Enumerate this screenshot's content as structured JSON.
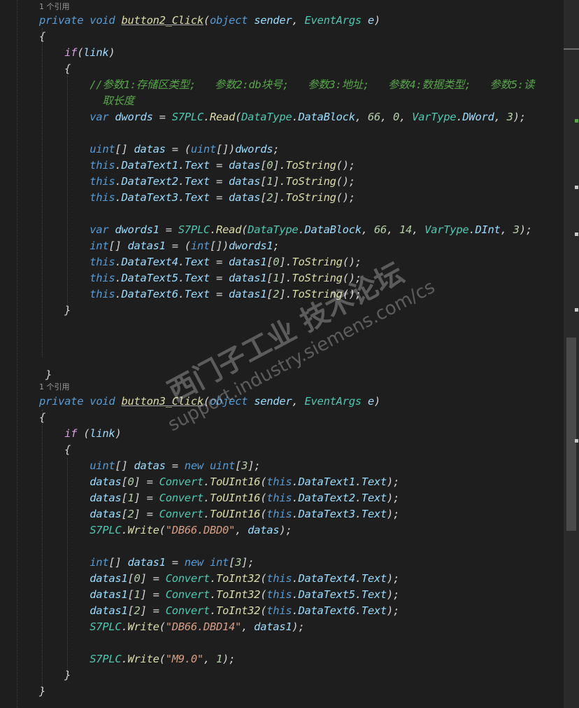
{
  "references": [
    "1 个引用",
    "1 个引用"
  ],
  "code_lines": [
    [
      [
        "kw",
        "private"
      ],
      [
        "pl",
        " "
      ],
      [
        "kw",
        "void"
      ],
      [
        "pl",
        " "
      ],
      [
        "mth",
        "button2_Click"
      ],
      [
        "pl",
        "("
      ],
      [
        "kw",
        "object"
      ],
      [
        "pl",
        " "
      ],
      [
        "id",
        "sender"
      ],
      [
        "pl",
        ", "
      ],
      [
        "typ",
        "EventArgs"
      ],
      [
        "pl",
        " "
      ],
      [
        "id",
        "e"
      ],
      [
        "pl",
        ")"
      ]
    ],
    [
      [
        "pl",
        "{"
      ]
    ],
    [
      [
        "pl",
        "    "
      ],
      [
        "ctl",
        "if"
      ],
      [
        "pl",
        "("
      ],
      [
        "id",
        "link"
      ],
      [
        "pl",
        ")"
      ]
    ],
    [
      [
        "pl",
        "    {"
      ]
    ],
    [
      [
        "pl",
        "        "
      ],
      [
        "com",
        "//参数1:存储区类型;   参数2:db块号;   参数3:地址;   参数4:数据类型;   参数5:读"
      ]
    ],
    [
      [
        "pl",
        "          "
      ],
      [
        "com",
        "取长度"
      ]
    ],
    [
      [
        "pl",
        "        "
      ],
      [
        "kw",
        "var"
      ],
      [
        "pl",
        " "
      ],
      [
        "id",
        "dwords"
      ],
      [
        "pl",
        " = "
      ],
      [
        "typ",
        "S7PLC"
      ],
      [
        "pl",
        "."
      ],
      [
        "mth",
        "Read"
      ],
      [
        "pl",
        "("
      ],
      [
        "typ",
        "DataType"
      ],
      [
        "pl",
        "."
      ],
      [
        "id",
        "DataBlock"
      ],
      [
        "pl",
        ", "
      ],
      [
        "num",
        "66"
      ],
      [
        "pl",
        ", "
      ],
      [
        "num",
        "0"
      ],
      [
        "pl",
        ", "
      ],
      [
        "typ",
        "VarType"
      ],
      [
        "pl",
        "."
      ],
      [
        "id",
        "DWord"
      ],
      [
        "pl",
        ", "
      ],
      [
        "num",
        "3"
      ],
      [
        "pl",
        ");"
      ]
    ],
    [
      [
        "pl",
        ""
      ]
    ],
    [
      [
        "pl",
        "        "
      ],
      [
        "kw",
        "uint"
      ],
      [
        "pl",
        "[] "
      ],
      [
        "id",
        "datas"
      ],
      [
        "pl",
        " = ("
      ],
      [
        "kw",
        "uint"
      ],
      [
        "pl",
        "[])"
      ],
      [
        "id",
        "dwords"
      ],
      [
        "pl",
        ";"
      ]
    ],
    [
      [
        "pl",
        "        "
      ],
      [
        "thisk",
        "this"
      ],
      [
        "pl",
        "."
      ],
      [
        "id",
        "DataText1"
      ],
      [
        "pl",
        "."
      ],
      [
        "id",
        "Text"
      ],
      [
        "pl",
        " = "
      ],
      [
        "id",
        "datas"
      ],
      [
        "pl",
        "["
      ],
      [
        "num",
        "0"
      ],
      [
        "pl",
        "]."
      ],
      [
        "mth",
        "ToString"
      ],
      [
        "pl",
        "();"
      ]
    ],
    [
      [
        "pl",
        "        "
      ],
      [
        "thisk",
        "this"
      ],
      [
        "pl",
        "."
      ],
      [
        "id",
        "DataText2"
      ],
      [
        "pl",
        "."
      ],
      [
        "id",
        "Text"
      ],
      [
        "pl",
        " = "
      ],
      [
        "id",
        "datas"
      ],
      [
        "pl",
        "["
      ],
      [
        "num",
        "1"
      ],
      [
        "pl",
        "]."
      ],
      [
        "mth",
        "ToString"
      ],
      [
        "pl",
        "();"
      ]
    ],
    [
      [
        "pl",
        "        "
      ],
      [
        "thisk",
        "this"
      ],
      [
        "pl",
        "."
      ],
      [
        "id",
        "DataText3"
      ],
      [
        "pl",
        "."
      ],
      [
        "id",
        "Text"
      ],
      [
        "pl",
        " = "
      ],
      [
        "id",
        "datas"
      ],
      [
        "pl",
        "["
      ],
      [
        "num",
        "2"
      ],
      [
        "pl",
        "]."
      ],
      [
        "mth",
        "ToString"
      ],
      [
        "pl",
        "();"
      ]
    ],
    [
      [
        "pl",
        ""
      ]
    ],
    [
      [
        "pl",
        "        "
      ],
      [
        "kw",
        "var"
      ],
      [
        "pl",
        " "
      ],
      [
        "id",
        "dwords1"
      ],
      [
        "pl",
        " = "
      ],
      [
        "typ",
        "S7PLC"
      ],
      [
        "pl",
        "."
      ],
      [
        "mth",
        "Read"
      ],
      [
        "pl",
        "("
      ],
      [
        "typ",
        "DataType"
      ],
      [
        "pl",
        "."
      ],
      [
        "id",
        "DataBlock"
      ],
      [
        "pl",
        ", "
      ],
      [
        "num",
        "66"
      ],
      [
        "pl",
        ", "
      ],
      [
        "num",
        "14"
      ],
      [
        "pl",
        ", "
      ],
      [
        "typ",
        "VarType"
      ],
      [
        "pl",
        "."
      ],
      [
        "id",
        "DInt"
      ],
      [
        "pl",
        ", "
      ],
      [
        "num",
        "3"
      ],
      [
        "pl",
        ");"
      ]
    ],
    [
      [
        "pl",
        "        "
      ],
      [
        "kw",
        "int"
      ],
      [
        "pl",
        "[] "
      ],
      [
        "id",
        "datas1"
      ],
      [
        "pl",
        " = ("
      ],
      [
        "kw",
        "int"
      ],
      [
        "pl",
        "[])"
      ],
      [
        "id",
        "dwords1"
      ],
      [
        "pl",
        ";"
      ]
    ],
    [
      [
        "pl",
        "        "
      ],
      [
        "thisk",
        "this"
      ],
      [
        "pl",
        "."
      ],
      [
        "id",
        "DataText4"
      ],
      [
        "pl",
        "."
      ],
      [
        "id",
        "Text"
      ],
      [
        "pl",
        " = "
      ],
      [
        "id",
        "datas1"
      ],
      [
        "pl",
        "["
      ],
      [
        "num",
        "0"
      ],
      [
        "pl",
        "]."
      ],
      [
        "mth",
        "ToString"
      ],
      [
        "pl",
        "();"
      ]
    ],
    [
      [
        "pl",
        "        "
      ],
      [
        "thisk",
        "this"
      ],
      [
        "pl",
        "."
      ],
      [
        "id",
        "DataText5"
      ],
      [
        "pl",
        "."
      ],
      [
        "id",
        "Text"
      ],
      [
        "pl",
        " = "
      ],
      [
        "id",
        "datas1"
      ],
      [
        "pl",
        "["
      ],
      [
        "num",
        "1"
      ],
      [
        "pl",
        "]."
      ],
      [
        "mth",
        "ToString"
      ],
      [
        "pl",
        "();"
      ]
    ],
    [
      [
        "pl",
        "        "
      ],
      [
        "thisk",
        "this"
      ],
      [
        "pl",
        "."
      ],
      [
        "id",
        "DataText6"
      ],
      [
        "pl",
        "."
      ],
      [
        "id",
        "Text"
      ],
      [
        "pl",
        " = "
      ],
      [
        "id",
        "datas1"
      ],
      [
        "pl",
        "["
      ],
      [
        "num",
        "2"
      ],
      [
        "pl",
        "]."
      ],
      [
        "mth",
        "ToString"
      ],
      [
        "pl",
        "();"
      ]
    ],
    [
      [
        "pl",
        "    }"
      ]
    ],
    [
      [
        "pl",
        ""
      ]
    ],
    [
      [
        "pl",
        ""
      ]
    ],
    [
      [
        "pl",
        ""
      ]
    ],
    [
      [
        "pl",
        " }"
      ]
    ],
    [
      [
        "pl",
        ""
      ]
    ],
    [
      [
        "pl",
        ""
      ]
    ],
    [
      [
        "kw",
        "private"
      ],
      [
        "pl",
        " "
      ],
      [
        "kw",
        "void"
      ],
      [
        "pl",
        " "
      ],
      [
        "mth",
        "button3_Click"
      ],
      [
        "pl",
        "("
      ],
      [
        "kw",
        "object"
      ],
      [
        "pl",
        " "
      ],
      [
        "id",
        "sender"
      ],
      [
        "pl",
        ", "
      ],
      [
        "typ",
        "EventArgs"
      ],
      [
        "pl",
        " "
      ],
      [
        "id",
        "e"
      ],
      [
        "pl",
        ")"
      ]
    ],
    [
      [
        "pl",
        "{"
      ]
    ],
    [
      [
        "pl",
        "    "
      ],
      [
        "ctl",
        "if"
      ],
      [
        "pl",
        " ("
      ],
      [
        "id",
        "link"
      ],
      [
        "pl",
        ")"
      ]
    ],
    [
      [
        "pl",
        "    {"
      ]
    ],
    [
      [
        "pl",
        "        "
      ],
      [
        "kw",
        "uint"
      ],
      [
        "pl",
        "[] "
      ],
      [
        "id",
        "datas"
      ],
      [
        "pl",
        " = "
      ],
      [
        "kw",
        "new"
      ],
      [
        "pl",
        " "
      ],
      [
        "kw",
        "uint"
      ],
      [
        "pl",
        "["
      ],
      [
        "num",
        "3"
      ],
      [
        "pl",
        "];"
      ]
    ],
    [
      [
        "pl",
        "        "
      ],
      [
        "id",
        "datas"
      ],
      [
        "pl",
        "["
      ],
      [
        "num",
        "0"
      ],
      [
        "pl",
        "] = "
      ],
      [
        "typ",
        "Convert"
      ],
      [
        "pl",
        "."
      ],
      [
        "mth",
        "ToUInt16"
      ],
      [
        "pl",
        "("
      ],
      [
        "thisk",
        "this"
      ],
      [
        "pl",
        "."
      ],
      [
        "id",
        "DataText1"
      ],
      [
        "pl",
        "."
      ],
      [
        "id",
        "Text"
      ],
      [
        "pl",
        ");"
      ]
    ],
    [
      [
        "pl",
        "        "
      ],
      [
        "id",
        "datas"
      ],
      [
        "pl",
        "["
      ],
      [
        "num",
        "1"
      ],
      [
        "pl",
        "] = "
      ],
      [
        "typ",
        "Convert"
      ],
      [
        "pl",
        "."
      ],
      [
        "mth",
        "ToUInt16"
      ],
      [
        "pl",
        "("
      ],
      [
        "thisk",
        "this"
      ],
      [
        "pl",
        "."
      ],
      [
        "id",
        "DataText2"
      ],
      [
        "pl",
        "."
      ],
      [
        "id",
        "Text"
      ],
      [
        "pl",
        ");"
      ]
    ],
    [
      [
        "pl",
        "        "
      ],
      [
        "id",
        "datas"
      ],
      [
        "pl",
        "["
      ],
      [
        "num",
        "2"
      ],
      [
        "pl",
        "] = "
      ],
      [
        "typ",
        "Convert"
      ],
      [
        "pl",
        "."
      ],
      [
        "mth",
        "ToUInt16"
      ],
      [
        "pl",
        "("
      ],
      [
        "thisk",
        "this"
      ],
      [
        "pl",
        "."
      ],
      [
        "id",
        "DataText3"
      ],
      [
        "pl",
        "."
      ],
      [
        "id",
        "Text"
      ],
      [
        "pl",
        ");"
      ]
    ],
    [
      [
        "pl",
        "        "
      ],
      [
        "typ",
        "S7PLC"
      ],
      [
        "pl",
        "."
      ],
      [
        "mth",
        "Write"
      ],
      [
        "pl",
        "("
      ],
      [
        "str",
        "\"DB66.DBD0\""
      ],
      [
        "pl",
        ", "
      ],
      [
        "id",
        "datas"
      ],
      [
        "pl",
        ");"
      ]
    ],
    [
      [
        "pl",
        ""
      ]
    ],
    [
      [
        "pl",
        "        "
      ],
      [
        "kw",
        "int"
      ],
      [
        "pl",
        "[] "
      ],
      [
        "id",
        "datas1"
      ],
      [
        "pl",
        " = "
      ],
      [
        "kw",
        "new"
      ],
      [
        "pl",
        " "
      ],
      [
        "kw",
        "int"
      ],
      [
        "pl",
        "["
      ],
      [
        "num",
        "3"
      ],
      [
        "pl",
        "];"
      ]
    ],
    [
      [
        "pl",
        "        "
      ],
      [
        "id",
        "datas1"
      ],
      [
        "pl",
        "["
      ],
      [
        "num",
        "0"
      ],
      [
        "pl",
        "] = "
      ],
      [
        "typ",
        "Convert"
      ],
      [
        "pl",
        "."
      ],
      [
        "mth",
        "ToInt32"
      ],
      [
        "pl",
        "("
      ],
      [
        "thisk",
        "this"
      ],
      [
        "pl",
        "."
      ],
      [
        "id",
        "DataText4"
      ],
      [
        "pl",
        "."
      ],
      [
        "id",
        "Text"
      ],
      [
        "pl",
        ");"
      ]
    ],
    [
      [
        "pl",
        "        "
      ],
      [
        "id",
        "datas1"
      ],
      [
        "pl",
        "["
      ],
      [
        "num",
        "1"
      ],
      [
        "pl",
        "] = "
      ],
      [
        "typ",
        "Convert"
      ],
      [
        "pl",
        "."
      ],
      [
        "mth",
        "ToInt32"
      ],
      [
        "pl",
        "("
      ],
      [
        "thisk",
        "this"
      ],
      [
        "pl",
        "."
      ],
      [
        "id",
        "DataText5"
      ],
      [
        "pl",
        "."
      ],
      [
        "id",
        "Text"
      ],
      [
        "pl",
        ");"
      ]
    ],
    [
      [
        "pl",
        "        "
      ],
      [
        "id",
        "datas1"
      ],
      [
        "pl",
        "["
      ],
      [
        "num",
        "2"
      ],
      [
        "pl",
        "] = "
      ],
      [
        "typ",
        "Convert"
      ],
      [
        "pl",
        "."
      ],
      [
        "mth",
        "ToInt32"
      ],
      [
        "pl",
        "("
      ],
      [
        "thisk",
        "this"
      ],
      [
        "pl",
        "."
      ],
      [
        "id",
        "DataText6"
      ],
      [
        "pl",
        "."
      ],
      [
        "id",
        "Text"
      ],
      [
        "pl",
        ");"
      ]
    ],
    [
      [
        "pl",
        "        "
      ],
      [
        "typ",
        "S7PLC"
      ],
      [
        "pl",
        "."
      ],
      [
        "mth",
        "Write"
      ],
      [
        "pl",
        "("
      ],
      [
        "str",
        "\"DB66.DBD14\""
      ],
      [
        "pl",
        ", "
      ],
      [
        "id",
        "datas1"
      ],
      [
        "pl",
        ");"
      ]
    ],
    [
      [
        "pl",
        ""
      ]
    ],
    [
      [
        "pl",
        "        "
      ],
      [
        "typ",
        "S7PLC"
      ],
      [
        "pl",
        "."
      ],
      [
        "mth",
        "Write"
      ],
      [
        "pl",
        "("
      ],
      [
        "str",
        "\"M9.0\""
      ],
      [
        "pl",
        ", "
      ],
      [
        "num",
        "1"
      ],
      [
        "pl",
        ");"
      ]
    ],
    [
      [
        "pl",
        "    }"
      ]
    ],
    [
      [
        "pl",
        "}"
      ]
    ]
  ],
  "watermark": {
    "line1": "西门子工业 技术论坛",
    "line2": "support.industry.siemens.com/cs"
  },
  "colors": {
    "background": "#1e1e1e",
    "keyword": "#569cd6",
    "control": "#d8a0df",
    "type": "#4ec9b0",
    "method": "#dcdcaa",
    "number": "#b5cea8",
    "string": "#d69d85",
    "comment": "#57a64a",
    "identifier": "#9cdcfe"
  }
}
